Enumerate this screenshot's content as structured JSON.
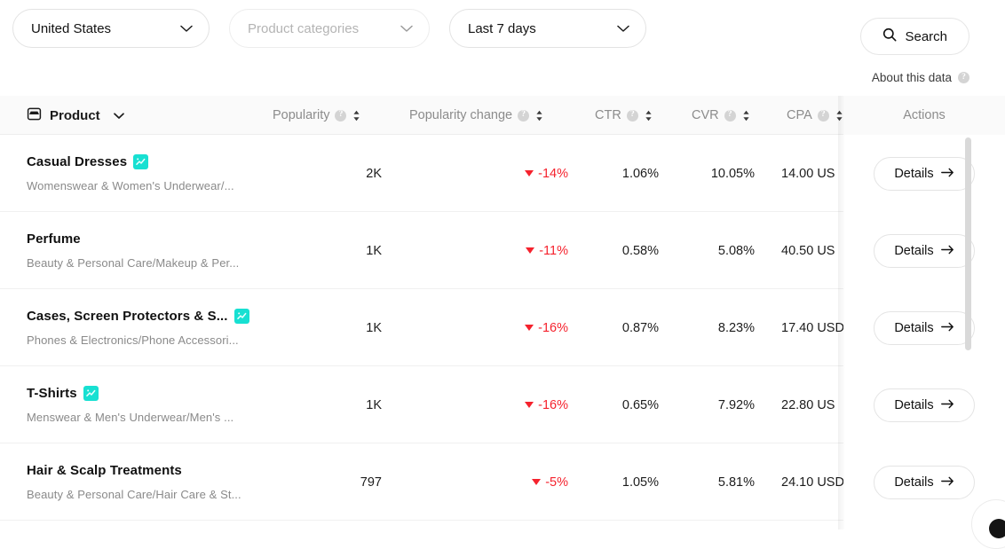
{
  "filters": [
    {
      "name": "country-filter",
      "label": "United States",
      "placeholder": false
    },
    {
      "name": "category-filter",
      "label": "Product categories",
      "placeholder": true
    },
    {
      "name": "date-filter",
      "label": "Last 7 days",
      "placeholder": false
    }
  ],
  "search": {
    "label": "Search",
    "icon": "search-icon"
  },
  "about": {
    "label": "About this data",
    "icon": "help-circle-icon"
  },
  "table": {
    "columns": {
      "product": {
        "label": "Product",
        "icon": "inbox-icon",
        "caret": "chevron-down-icon"
      },
      "popularity": {
        "label": "Popularity",
        "help": "?",
        "sort": "sort-icon"
      },
      "popchange": {
        "label": "Popularity change",
        "help": "?",
        "sort": "sort-icon"
      },
      "ctr": {
        "label": "CTR",
        "help": "?",
        "sort": "sort-icon"
      },
      "cvr": {
        "label": "CVR",
        "help": "?",
        "sort": "sort-icon"
      },
      "cpa": {
        "label": "CPA",
        "help": "?",
        "sort": "sort-icon"
      },
      "actions": {
        "label": "Actions"
      }
    },
    "action_button_label": "Details",
    "rows": [
      {
        "name": "Casual Dresses",
        "badge": "trending-badge-icon",
        "category": "Womenswear & Women's Underwear/...",
        "popularity": "2K",
        "popularity_change": "-14%",
        "change_direction": "down",
        "ctr": "1.06%",
        "cvr": "10.05%",
        "cpa": "14.00 US"
      },
      {
        "name": "Perfume",
        "badge": null,
        "category": "Beauty & Personal Care/Makeup & Per...",
        "popularity": "1K",
        "popularity_change": "-11%",
        "change_direction": "down",
        "ctr": "0.58%",
        "cvr": "5.08%",
        "cpa": "40.50 US"
      },
      {
        "name": "Cases, Screen Protectors & S...",
        "badge": "trending-badge-icon",
        "category": "Phones & Electronics/Phone Accessori...",
        "popularity": "1K",
        "popularity_change": "-16%",
        "change_direction": "down",
        "ctr": "0.87%",
        "cvr": "8.23%",
        "cpa": "17.40 USD"
      },
      {
        "name": "T-Shirts",
        "badge": "trending-badge-icon",
        "category": "Menswear & Men's Underwear/Men's ...",
        "popularity": "1K",
        "popularity_change": "-16%",
        "change_direction": "down",
        "ctr": "0.65%",
        "cvr": "7.92%",
        "cpa": "22.80 US"
      },
      {
        "name": "Hair & Scalp Treatments",
        "badge": null,
        "category": "Beauty & Personal Care/Hair Care & St...",
        "popularity": "797",
        "popularity_change": "-5%",
        "change_direction": "down",
        "ctr": "1.05%",
        "cvr": "5.81%",
        "cpa": "24.10 USD"
      }
    ]
  },
  "colors": {
    "negative": "#f5222d",
    "badge": "#17e0d2",
    "header_bg": "#fafafa",
    "muted_text": "#8c8c8c"
  }
}
